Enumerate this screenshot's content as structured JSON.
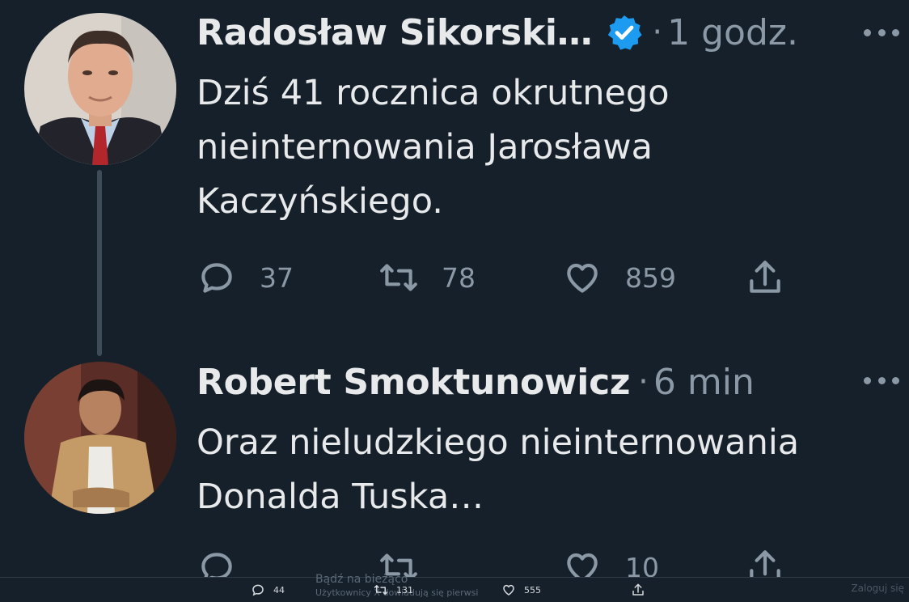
{
  "tweets": [
    {
      "author": "Radosław Sikorski…",
      "verified": true,
      "time": "1 godz.",
      "separator": "·",
      "lines": [
        "Dziś 41 rocznica okrutnego",
        "nieinternowania Jarosława",
        "Kaczyńskiego."
      ],
      "replies": "37",
      "retweets": "78",
      "likes": "859"
    },
    {
      "author": "Robert Smoktunowicz",
      "verified": false,
      "time": "6 min",
      "separator": "·",
      "lines": [
        "Oraz nieludzkiego nieinternowania",
        "Donalda Tuska…"
      ],
      "replies": "",
      "retweets": "",
      "likes": "10"
    }
  ],
  "bottom_bar": {
    "replies": "44",
    "retweets": "131",
    "likes": "555",
    "faded_text_1": "Bądź na bieżąco",
    "faded_text_2": "Użytkownicy X dowiadują się pierwsi",
    "login": "Zaloguj się"
  },
  "icons": {
    "reply": "reply-icon",
    "retweet": "retweet-icon",
    "like": "heart-icon",
    "share": "share-icon",
    "more": "more-icon",
    "verified": "verified-badge-icon"
  },
  "colors": {
    "background": "#15202b",
    "text": "#e7e9ea",
    "muted": "#8b98a5",
    "verified": "#1d9bf0"
  }
}
